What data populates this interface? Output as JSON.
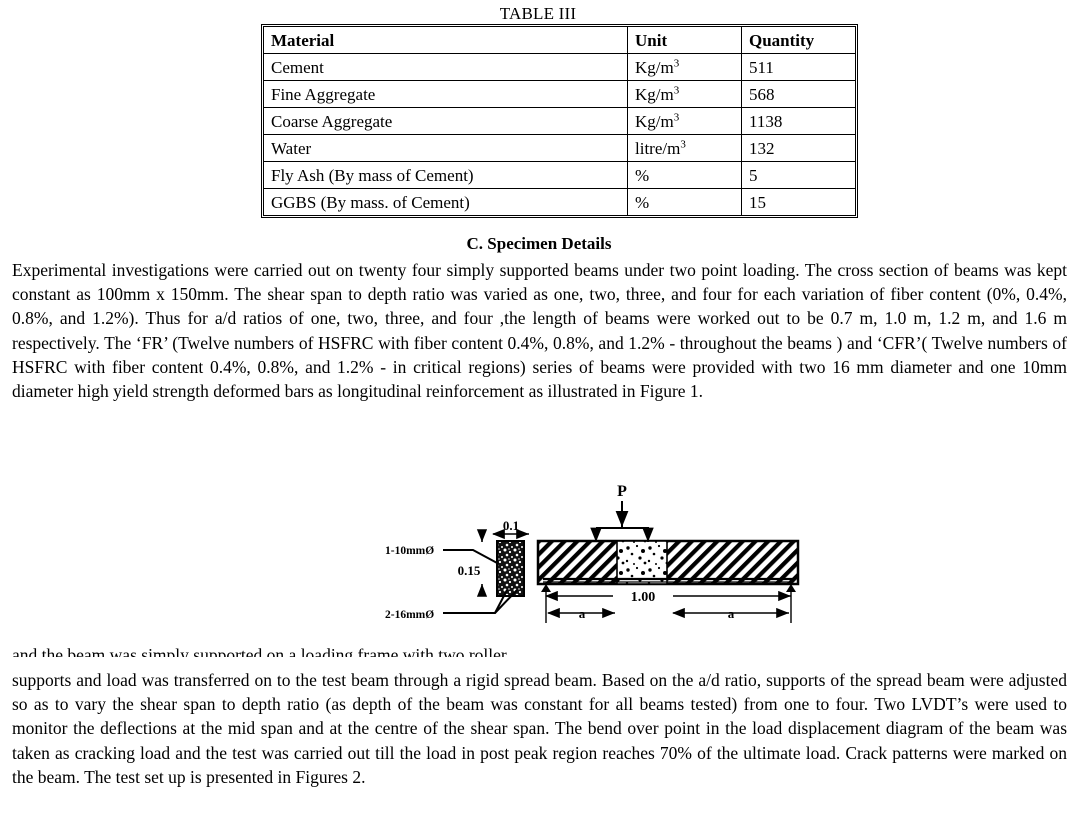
{
  "table": {
    "caption": "TABLE III",
    "headers": [
      "Material",
      "Unit",
      "Quantity"
    ],
    "rows": [
      {
        "material": "Cement",
        "unit": "Kg/m",
        "unit_sup": "3",
        "unit_bold": false,
        "quantity": "511"
      },
      {
        "material": "Fine Aggregate",
        "unit": "Kg/m",
        "unit_sup": "3",
        "unit_bold": false,
        "quantity": "568"
      },
      {
        "material": "Coarse Aggregate",
        "unit": "Kg/m",
        "unit_sup": "3",
        "unit_bold": false,
        "quantity": "1138"
      },
      {
        "material": "Water",
        "unit": "litre/m",
        "unit_sup": "3",
        "unit_bold": false,
        "quantity": "132"
      },
      {
        "material": "Fly Ash (By mass of Cement)",
        "unit": "%",
        "unit_sup": "",
        "unit_bold": true,
        "quantity": "5"
      },
      {
        "material": "GGBS (By mass. of Cement)",
        "unit": "%",
        "unit_sup": "",
        "unit_bold": true,
        "quantity": "15"
      }
    ]
  },
  "section": {
    "heading": "C. Specimen Details",
    "specimen_paragraph": "Experimental investigations were carried out on twenty four simply supported beams under two point loading. The cross section of beams was kept constant as 100mm x 150mm. The shear span to depth ratio was varied as one, two, three, and four for each variation of fiber content (0%, 0.4%, 0.8%, and 1.2%). Thus for a/d ratios of one, two, three, and four ,the length of beams were  worked out to be 0.7 m, 1.0 m, 1.2 m, and 1.6 m respectively.  The  ‘FR’ (Twelve numbers of  HSFRC with fiber content 0.4%, 0.8%, and 1.2% - throughout the beams )  and ‘CFR’( Twelve numbers of  HSFRC with fiber content 0.4%, 0.8%, and 1.2%  - in critical regions)   series of beams were provided with two 16 mm diameter  and  one 10mm diameter high yield strength deformed bars as longitudinal reinforcement as illustrated in Figure 1.",
    "clipped_line": "and the beam was simply supported on a loading frame with two roller",
    "setup_paragraph": "supports and load was transferred on to the test beam through a rigid spread beam. Based on the a/d ratio, supports of the spread beam were adjusted so as to vary the shear span to depth ratio (as depth of the beam was constant for all beams tested) from one to four. Two LVDT’s were used to monitor the deflections at the mid span and at the centre of the shear span. The bend over point in the load displacement diagram of the beam was taken as cracking load and the test was carried out till the load in post peak region reaches 70% of the ultimate load. Crack patterns were marked on the beam. The test set up is presented in Figures 2."
  },
  "figure": {
    "load_label": "P",
    "top_bar_label": "1-10mmØ",
    "bottom_bar_label": "2-16mmØ",
    "width_dim": "0.1",
    "depth_dim": "0.15",
    "span_dim": "1.00",
    "shear_span_left": "a",
    "shear_span_right": "a"
  }
}
